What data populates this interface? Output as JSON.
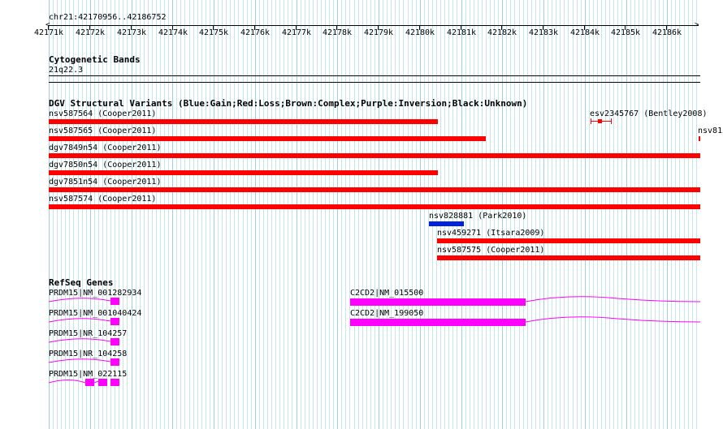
{
  "coord": {
    "region": "chr21:42170956..42186752",
    "ticks": [
      "42171k",
      "42172k",
      "42173k",
      "42174k",
      "42175k",
      "42176k",
      "42177k",
      "42178k",
      "42179k",
      "42180k",
      "42181k",
      "42182k",
      "42183k",
      "42184k",
      "42185k",
      "42186k"
    ]
  },
  "tracks": {
    "cytoband": {
      "title": "Cytogenetic Bands",
      "band": "21q22.3"
    },
    "dgv": {
      "title": "DGV Structural Variants (Blue:Gain;Red:Loss;Brown:Complex;Purple:Inversion;Black:Unknown)",
      "variants": [
        {
          "label": "nsv587564 (Cooper2011)",
          "color": "#ff0000"
        },
        {
          "label": "esv2345767 (Bentley2008)",
          "color": "#ff0000"
        },
        {
          "label": "nsv587565 (Cooper2011)",
          "color": "#ff0000"
        },
        {
          "label": "nsv81",
          "color": "#ff0000"
        },
        {
          "label": "dgv7849n54 (Cooper2011)",
          "color": "#ff0000"
        },
        {
          "label": "dgv7850n54 (Cooper2011)",
          "color": "#ff0000"
        },
        {
          "label": "dgv7851n54 (Cooper2011)",
          "color": "#ff0000"
        },
        {
          "label": "nsv587574 (Cooper2011)",
          "color": "#ff0000"
        },
        {
          "label": "nsv828881 (Park2010)",
          "color": "#0022dd"
        },
        {
          "label": "nsv459271 (Itsara2009)",
          "color": "#ff0000"
        },
        {
          "label": "nsv587575 (Cooper2011)",
          "color": "#ff0000"
        }
      ]
    },
    "refseq": {
      "title": "RefSeq Genes",
      "color": "#ff00ff",
      "genes": [
        {
          "label": "PRDM15|NM_001282934"
        },
        {
          "label": "PRDM15|NM_001040424"
        },
        {
          "label": "PRDM15|NR_104257"
        },
        {
          "label": "PRDM15|NR_104258"
        },
        {
          "label": "PRDM15|NM_022115"
        },
        {
          "label": "C2CD2|NM_015500"
        },
        {
          "label": "C2CD2|NM_199050"
        }
      ]
    }
  }
}
